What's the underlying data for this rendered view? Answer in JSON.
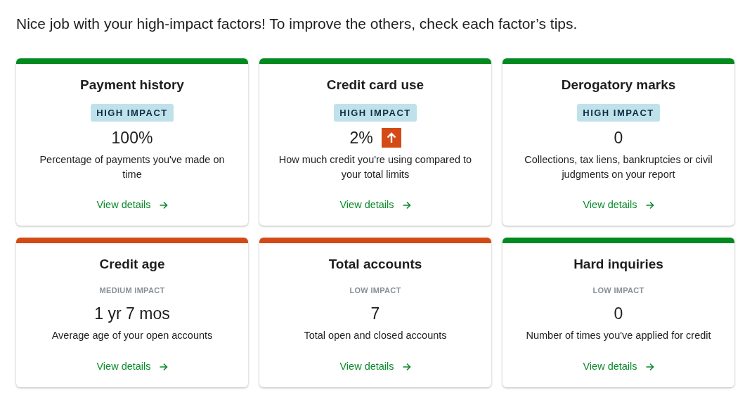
{
  "heading": "Nice job with your high-impact factors! To improve the others, check each factor’s tips.",
  "factors": [
    {
      "title": "Payment history",
      "color": "#008a1f",
      "impact": {
        "kind": "high",
        "label": "HIGH IMPACT"
      },
      "value": "100%",
      "description": "Percentage of payments you've made on time",
      "link": "View details"
    },
    {
      "title": "Credit card use",
      "color": "#008a1f",
      "impact": {
        "kind": "high",
        "label": "HIGH IMPACT"
      },
      "value": "2%",
      "rising": true,
      "description": "How much credit you're using compared to your total limits",
      "link": "View details"
    },
    {
      "title": "Derogatory marks",
      "color": "#008a1f",
      "impact": {
        "kind": "high",
        "label": "HIGH IMPACT"
      },
      "value": "0",
      "description": "Collections, tax liens, bankruptcies or civil judgments on your report",
      "link": "View details"
    },
    {
      "title": "Credit age",
      "color": "#d34a16",
      "impact": {
        "kind": "low",
        "label": "MEDIUM IMPACT"
      },
      "value": "1 yr 7 mos",
      "description": "Average age of your open accounts",
      "link": "View details"
    },
    {
      "title": "Total accounts",
      "color": "#d34a16",
      "impact": {
        "kind": "low",
        "label": "LOW IMPACT"
      },
      "value": "7",
      "description": "Total open and closed accounts",
      "link": "View details"
    },
    {
      "title": "Hard inquiries",
      "color": "#008a1f",
      "impact": {
        "kind": "low",
        "label": "LOW IMPACT"
      },
      "value": "0",
      "description": "Number of times you've applied for credit",
      "link": "View details"
    }
  ]
}
